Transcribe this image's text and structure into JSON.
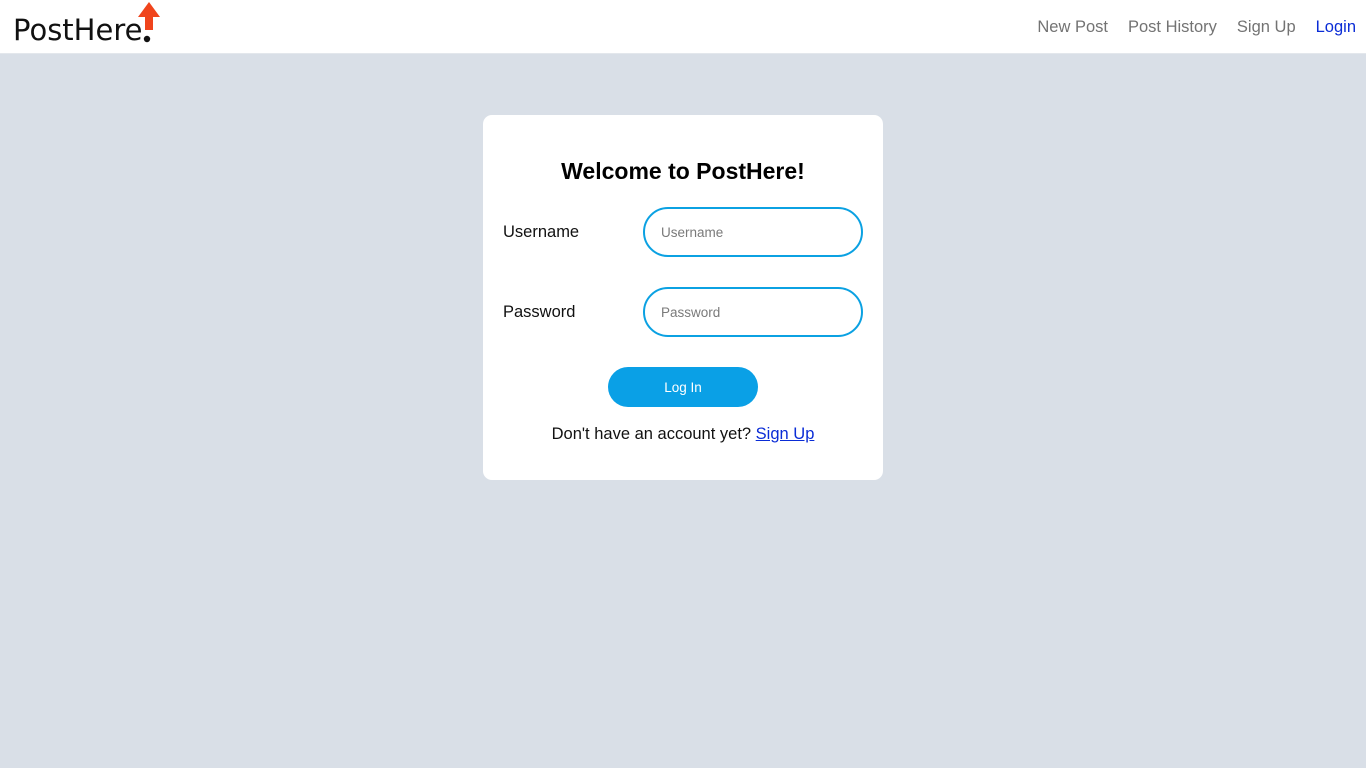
{
  "brand": {
    "logo_text": "PostHere",
    "logo_accent_color": "#f0441c"
  },
  "nav": {
    "items": [
      {
        "label": "New Post"
      },
      {
        "label": "Post History"
      },
      {
        "label": "Sign Up"
      },
      {
        "label": "Login",
        "active": true
      }
    ],
    "active_color": "#0a2cd6",
    "inactive_color": "#737373"
  },
  "login_card": {
    "title": "Welcome to PostHere!",
    "username": {
      "label": "Username",
      "placeholder": "Username",
      "value": ""
    },
    "password": {
      "label": "Password",
      "placeholder": "Password",
      "value": ""
    },
    "submit_label": "Log In",
    "footer_text": "Don't have an account yet?",
    "footer_link": "Sign Up"
  },
  "colors": {
    "page_background": "#d9dfe7",
    "accent": "#0aa0e6",
    "input_border": "#0ba1e2"
  }
}
